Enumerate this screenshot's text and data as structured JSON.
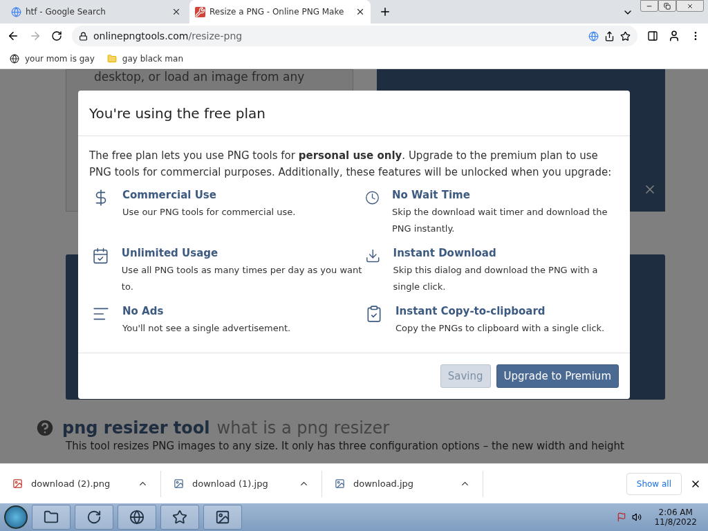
{
  "tabs": [
    {
      "title": "htf - Google Search",
      "selected": false
    },
    {
      "title": "Resize a PNG - Online PNG Make",
      "selected": true
    }
  ],
  "address": {
    "host": "onlinepngtools.com",
    "path": "/resize-png"
  },
  "bookmarks": [
    "your mom is gay",
    "gay black man"
  ],
  "page": {
    "intro_text": "desktop, or load an image from any",
    "heading": "png resizer tool",
    "subheading": "what is a png resizer",
    "paragraph": "This tool resizes PNG images to any size. It only has three configuration options – the new width and height"
  },
  "dialog": {
    "title": "You're using the free plan",
    "intro": "The free plan lets you use PNG tools for **personal use only**. Upgrade to the premium plan to use PNG tools for commercial purposes. Additionally, these features will be unlocked when you upgrade:",
    "features": [
      {
        "title": "Commercial Use",
        "text": "Use our PNG tools for commercial use."
      },
      {
        "title": "No Wait Time",
        "text": "Skip the download wait timer and download the PNG instantly."
      },
      {
        "title": "Unlimited Usage",
        "text": "Use all PNG tools as many times per day as you want to."
      },
      {
        "title": "Instant Download",
        "text": "Skip this dialog and download the PNG with a single click."
      },
      {
        "title": "No Ads",
        "text": "You'll not see a single advertisement."
      },
      {
        "title": "Instant Copy-to-clipboard",
        "text": "Copy the PNGs to clipboard with a single click."
      }
    ],
    "buttons": [
      {
        "label": "Saving",
        "disabled": true
      },
      {
        "label": "Upgrade to Premium",
        "disabled": false
      }
    ]
  },
  "downloads": {
    "items": [
      "download (2).png",
      "download (1).jpg",
      "download.jpg"
    ],
    "show_all": "Show all"
  },
  "clock": {
    "time": "2:06 AM",
    "date": "11/8/2022"
  }
}
